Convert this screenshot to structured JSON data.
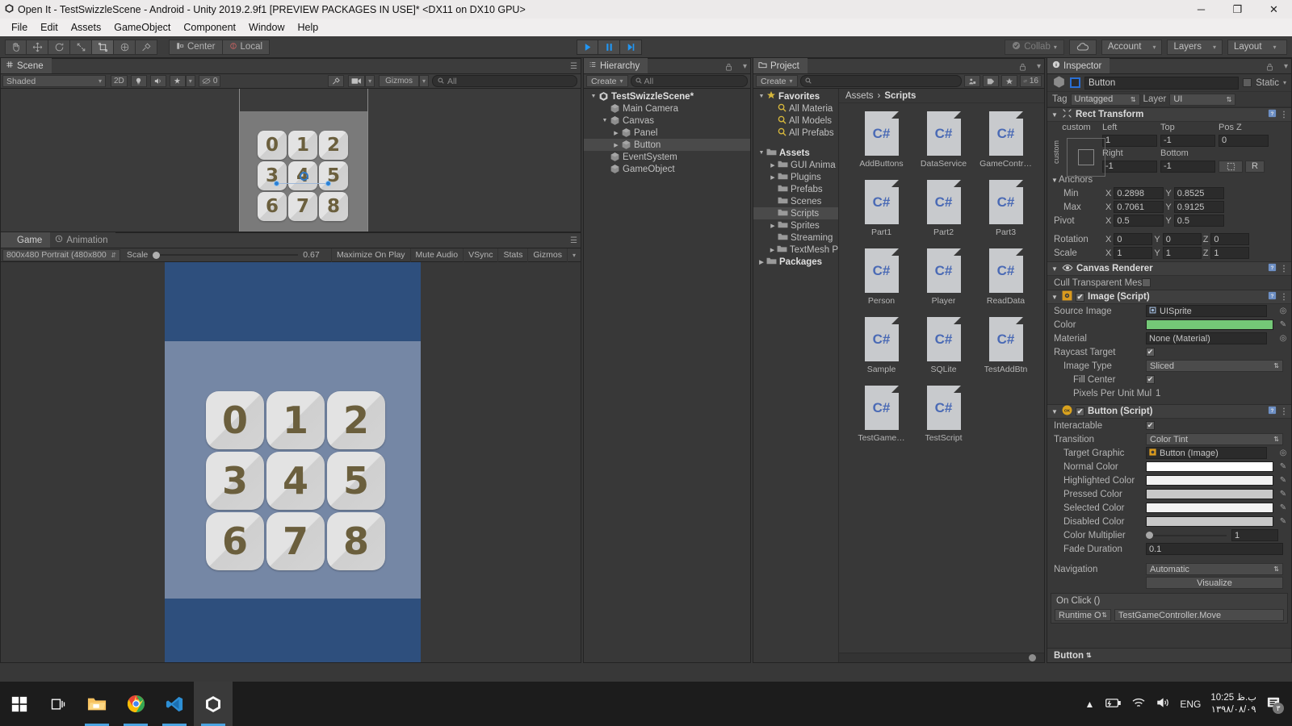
{
  "window": {
    "title": "Open It - TestSwizzleScene - Android - Unity 2019.2.9f1 [PREVIEW PACKAGES IN USE]* <DX11 on DX10 GPU>",
    "minimize": "─",
    "maximize": "❐",
    "close": "✕"
  },
  "menu": [
    "File",
    "Edit",
    "Assets",
    "GameObject",
    "Component",
    "Window",
    "Help"
  ],
  "toolbar": {
    "tools": [
      "hand-tool",
      "move-tool",
      "rotate-tool",
      "scale-tool",
      "rect-tool",
      "transform-tool",
      "custom-tool"
    ],
    "pivot": "Center",
    "space": "Local",
    "play": "▶",
    "pause": "‖",
    "step": "▶|",
    "collab": "Collab",
    "cloud": "☁",
    "account": "Account",
    "layers": "Layers",
    "layout": "Layout",
    "caret": "▾"
  },
  "scene": {
    "tab": "Scene",
    "shading": "Shaded",
    "mode2d": "2D",
    "lighting": "●",
    "audio": "🔊",
    "fx": "✦",
    "hidden_count": "0",
    "gizmos": "Gizmos",
    "search_placeholder": "All",
    "tiles": [
      "0",
      "1",
      "2",
      "3",
      "4",
      "5",
      "6",
      "7",
      "8"
    ]
  },
  "game": {
    "tabs": [
      {
        "label": "Game",
        "selected": true,
        "icon": "game-icon"
      },
      {
        "label": "Animation",
        "selected": false,
        "icon": "clock-icon"
      }
    ],
    "aspect": "800x480 Portrait (480x800",
    "scale_label": "Scale",
    "scale_value": "0.67",
    "toggles": [
      "Maximize On Play",
      "Mute Audio",
      "VSync",
      "Stats",
      "Gizmos"
    ],
    "tiles": [
      "0",
      "1",
      "2",
      "3",
      "4",
      "5",
      "6",
      "7",
      "8"
    ],
    "colors": {
      "band_dark": "#2e4f7d",
      "band_light": "#7587a5",
      "tile_face": "#e1e1e1",
      "tile_text": "#6b5f3d"
    }
  },
  "hierarchy": {
    "tab": "Hierarchy",
    "create": "Create",
    "search_placeholder": "All",
    "items": [
      {
        "label": "TestSwizzleScene*",
        "depth": 0,
        "arrow": "▼",
        "root": true,
        "selected": false
      },
      {
        "label": "Main Camera",
        "depth": 1,
        "arrow": "",
        "root": false,
        "selected": false
      },
      {
        "label": "Canvas",
        "depth": 1,
        "arrow": "▼",
        "root": false,
        "selected": false
      },
      {
        "label": "Panel",
        "depth": 2,
        "arrow": "▶",
        "root": false,
        "selected": false
      },
      {
        "label": "Button",
        "depth": 2,
        "arrow": "▶",
        "root": false,
        "selected": true
      },
      {
        "label": "EventSystem",
        "depth": 1,
        "arrow": "",
        "root": false,
        "selected": false
      },
      {
        "label": "GameObject",
        "depth": 1,
        "arrow": "",
        "root": false,
        "selected": false
      }
    ]
  },
  "project": {
    "tab": "Project",
    "create": "Create",
    "search_placeholder": "",
    "item_count": "16",
    "breadcrumb": [
      "Assets",
      "Scripts"
    ],
    "tree": [
      {
        "label": "Favorites",
        "type": "star",
        "depth": 0,
        "arrow": "▼",
        "bold": true,
        "selected": false
      },
      {
        "label": "All Materia",
        "type": "search",
        "depth": 1,
        "arrow": "",
        "bold": false,
        "selected": false
      },
      {
        "label": "All Models",
        "type": "search",
        "depth": 1,
        "arrow": "",
        "bold": false,
        "selected": false
      },
      {
        "label": "All Prefabs",
        "type": "search",
        "depth": 1,
        "arrow": "",
        "bold": false,
        "selected": false
      },
      {
        "label": "",
        "type": "spacer",
        "depth": 0,
        "arrow": "",
        "bold": false,
        "selected": false
      },
      {
        "label": "Assets",
        "type": "folder",
        "depth": 0,
        "arrow": "▼",
        "bold": true,
        "selected": false
      },
      {
        "label": "GUI Anima",
        "type": "folder",
        "depth": 1,
        "arrow": "▶",
        "bold": false,
        "selected": false
      },
      {
        "label": "Plugins",
        "type": "folder",
        "depth": 1,
        "arrow": "▶",
        "bold": false,
        "selected": false
      },
      {
        "label": "Prefabs",
        "type": "folder",
        "depth": 1,
        "arrow": "",
        "bold": false,
        "selected": false
      },
      {
        "label": "Scenes",
        "type": "folder",
        "depth": 1,
        "arrow": "",
        "bold": false,
        "selected": false
      },
      {
        "label": "Scripts",
        "type": "folder",
        "depth": 1,
        "arrow": "",
        "bold": false,
        "selected": true
      },
      {
        "label": "Sprites",
        "type": "folder",
        "depth": 1,
        "arrow": "▶",
        "bold": false,
        "selected": false
      },
      {
        "label": "Streaming",
        "type": "folder",
        "depth": 1,
        "arrow": "",
        "bold": false,
        "selected": false
      },
      {
        "label": "TextMesh P",
        "type": "folder",
        "depth": 1,
        "arrow": "▶",
        "bold": false,
        "selected": false
      },
      {
        "label": "Packages",
        "type": "folder",
        "depth": 0,
        "arrow": "▶",
        "bold": true,
        "selected": false
      }
    ],
    "assets": [
      {
        "name": "AddButtons",
        "kind": "C#"
      },
      {
        "name": "DataService",
        "kind": "C#"
      },
      {
        "name": "GameContr…",
        "kind": "C#"
      },
      {
        "name": "Part1",
        "kind": "C#"
      },
      {
        "name": "Part2",
        "kind": "C#"
      },
      {
        "name": "Part3",
        "kind": "C#"
      },
      {
        "name": "Person",
        "kind": "C#"
      },
      {
        "name": "Player",
        "kind": "C#"
      },
      {
        "name": "ReadData",
        "kind": "C#"
      },
      {
        "name": "Sample",
        "kind": "C#"
      },
      {
        "name": "SQLite",
        "kind": "C#"
      },
      {
        "name": "TestAddBtn",
        "kind": "C#"
      },
      {
        "name": "TestGame…",
        "kind": "C#"
      },
      {
        "name": "TestScript",
        "kind": "C#"
      }
    ]
  },
  "inspector": {
    "tab": "Inspector",
    "object_name": "Button",
    "static_label": "Static",
    "tag_label": "Tag",
    "tag_value": "Untagged",
    "layer_label": "Layer",
    "layer_value": "UI",
    "rect_transform": {
      "title": "Rect Transform",
      "anchor_preset": "custom",
      "left_label": "Left",
      "left": "1",
      "top_label": "Top",
      "top": "-1",
      "posz_label": "Pos Z",
      "posz": "0",
      "right_label": "Right",
      "right": "-1",
      "bottom_label": "Bottom",
      "bottom": "-1",
      "anchors_label": "Anchors",
      "min_label": "Min",
      "min_x": "0.2898",
      "min_y": "0.8525",
      "max_label": "Max",
      "max_x": "0.7061",
      "max_y": "0.9125",
      "pivot_label": "Pivot",
      "pivot_x": "0.5",
      "pivot_y": "0.5",
      "rotation_label": "Rotation",
      "rot_x": "0",
      "rot_y": "0",
      "rot_z": "0",
      "scale_label": "Scale",
      "scale_x": "1",
      "scale_y": "1",
      "scale_z": "1",
      "blueprint": "R"
    },
    "canvas_renderer": {
      "title": "Canvas Renderer",
      "cull_label": "Cull Transparent Mes",
      "cull_checked": false
    },
    "image_script": {
      "title": "Image (Script)",
      "enabled": true,
      "source_image_label": "Source Image",
      "source_image_value": "UISprite",
      "color_label": "Color",
      "color_value": "#74c877",
      "material_label": "Material",
      "material_value": "None (Material)",
      "raycast_label": "Raycast Target",
      "raycast_checked": true,
      "image_type_label": "Image Type",
      "image_type_value": "Sliced",
      "fill_center_label": "Fill Center",
      "fill_center_checked": true,
      "ppu_label": "Pixels Per Unit Mul",
      "ppu_value": "1"
    },
    "button_script": {
      "title": "Button (Script)",
      "enabled": true,
      "interactable_label": "Interactable",
      "interactable_checked": true,
      "transition_label": "Transition",
      "transition_value": "Color Tint",
      "target_graphic_label": "Target Graphic",
      "target_graphic_value": "Button (Image)",
      "colors": [
        {
          "label": "Normal Color",
          "value": "#ffffff"
        },
        {
          "label": "Highlighted Color",
          "value": "#f2f2f2"
        },
        {
          "label": "Pressed Color",
          "value": "#c8c8c8"
        },
        {
          "label": "Selected Color",
          "value": "#f2f2f2"
        },
        {
          "label": "Disabled Color",
          "value": "#c8c8c8"
        }
      ],
      "color_multiplier_label": "Color Multiplier",
      "color_multiplier_value": "1",
      "fade_duration_label": "Fade Duration",
      "fade_duration_value": "0.1",
      "navigation_label": "Navigation",
      "navigation_value": "Automatic",
      "visualize_label": "Visualize",
      "onclick_label": "On Click ()",
      "onclick_runtime": "Runtime O",
      "onclick_function": "TestGameController.Move"
    },
    "status": "Button"
  },
  "taskbar": {
    "icons": [
      "windows-start-icon",
      "task-view-icon",
      "file-explorer-icon",
      "chrome-icon",
      "vscode-icon",
      "unity-icon"
    ],
    "tray": [
      "chevron-up-icon",
      "battery-icon",
      "wifi-icon",
      "volume-icon"
    ],
    "language": "ENG",
    "time": "10:25 ب.ظ",
    "date": "۱۳۹۸/۰۸/۰۹",
    "notification": "notification-icon",
    "notification_count": "۳"
  }
}
